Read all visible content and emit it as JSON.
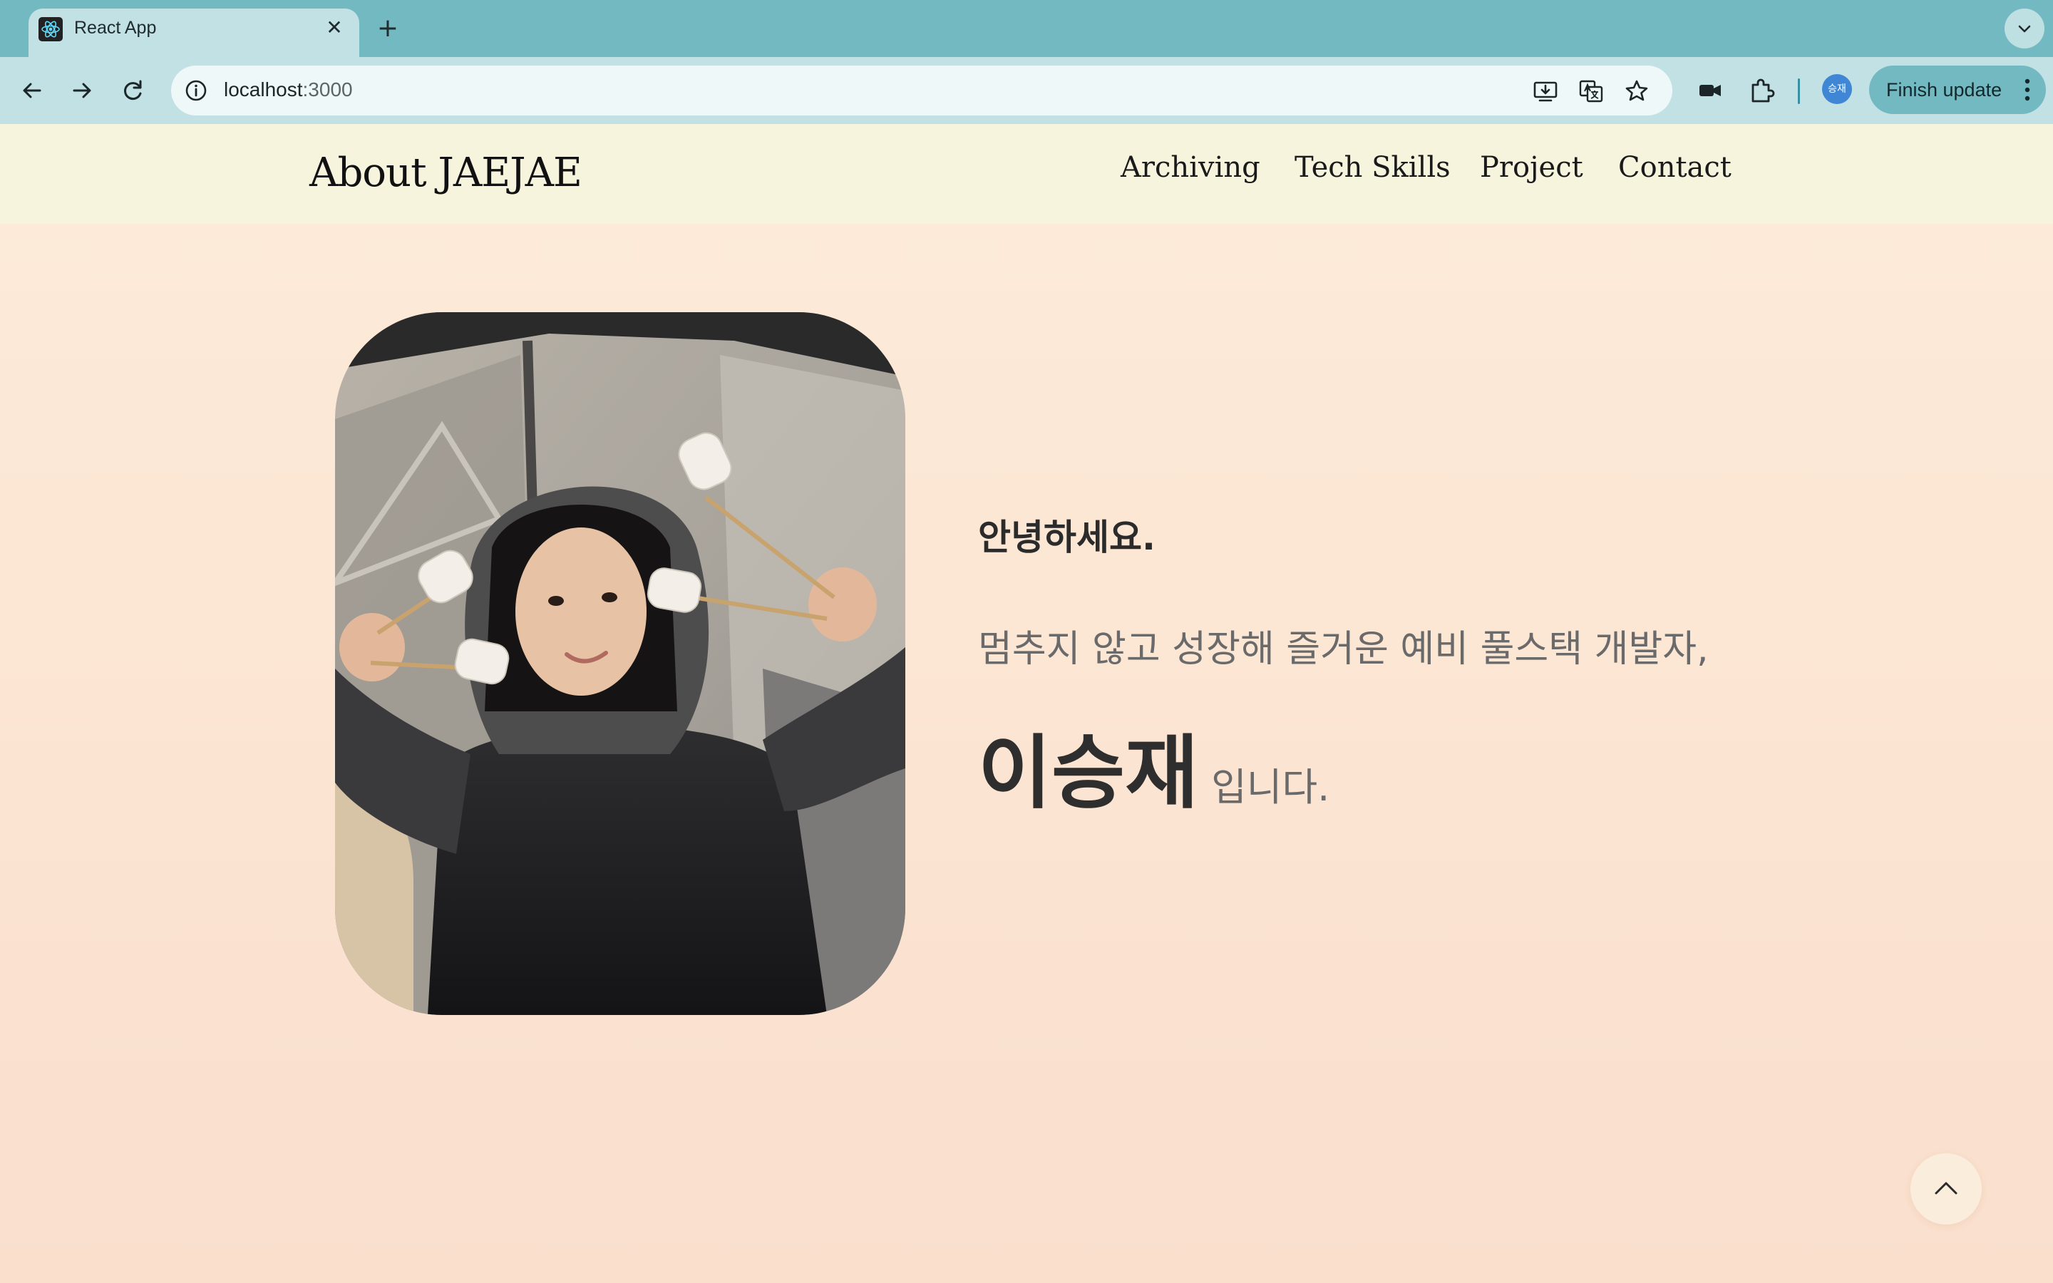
{
  "browser": {
    "tab_title": "React App",
    "tab_close": "✕",
    "new_tab": "+",
    "url_host": "localhost",
    "url_port": ":3000",
    "finish_update": "Finish update",
    "profile_initials": "승재"
  },
  "site": {
    "logo": "About JAEJAE",
    "nav": [
      "Archiving",
      "Tech Skills",
      "Project",
      "Contact"
    ]
  },
  "hero": {
    "greeting": "안녕하세요.",
    "tagline": "멈추지 않고 성장해 즐거운 예비 풀스택 개발자,",
    "name": "이승재",
    "name_suffix": "입니다."
  },
  "colors": {
    "tab_strip": "#72b9c1",
    "toolbar": "#c1e1e4",
    "header_bg": "#f6f4dd",
    "page_bg_top": "#fdebd9",
    "page_bg_bottom": "#fadfcd"
  },
  "icons": {
    "favicon": "react-icon",
    "scroll_top": "chevron-up-icon"
  }
}
